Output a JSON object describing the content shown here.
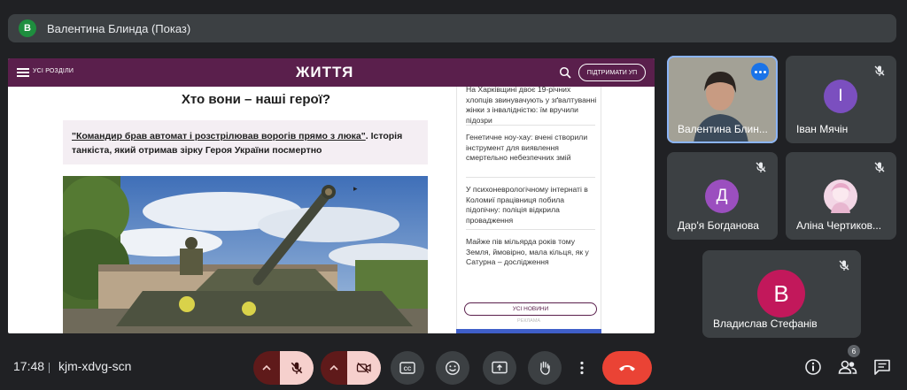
{
  "presenter": {
    "avatar_letter": "В",
    "label": "Валентина Блинда (Показ)"
  },
  "shared_screen": {
    "menu_label": "УСІ РОЗДІЛИ",
    "logo": "ЖИТТЯ",
    "support_button": "ПІДТРИМАТИ УП",
    "article_title": "Хто вони – наші герої?",
    "quote_link_underlined": "\"Командир брав автомат і розстрілював ворогів прямо з люка\"",
    "quote_link_rest": ". Історія танкіста, який отримав зірку Героя України посмертно",
    "news_items": [
      "На Харківщині двоє 19-річних хлопців звинувачують у зґвалтуванні жінки з інвалідністю: їм вручили підозри",
      "Генетичне ноу-хау: вчені створили інструмент для виявлення смертельно небезпечних змій",
      "У психоневрологічному інтернаті в Коломиї працівниця побила підопічну: поліція відкрила провадження",
      "Майже пів мільярда років тому Земля, ймовірно, мала кільця, як у Сатурна – дослідження"
    ],
    "all_news_button": "УСІ НОВИНИ",
    "ad_label": "РЕКЛАМА"
  },
  "participants": [
    {
      "name": "Валентина Блин...",
      "is_self": true
    },
    {
      "name": "Іван Мячін",
      "avatar_letter": "І",
      "avatar_color": "#7b4fbf",
      "muted": true
    },
    {
      "name": "Дар'я Богданова",
      "avatar_letter": "Д",
      "avatar_color": "#9b4fbf",
      "muted": true
    },
    {
      "name": "Аліна Чертиков...",
      "muted": true,
      "has_photo_avatar": true
    },
    {
      "name": "Владислав Стефанів",
      "avatar_letter": "В",
      "avatar_color": "#c2185b",
      "muted": true
    }
  ],
  "toolbar": {
    "time": "17:48",
    "meeting_code": "kjm-xdvg-scn",
    "participant_count": "6"
  },
  "colors": {
    "meet_background": "#202124",
    "tile_background": "#3c4043",
    "end_call": "#ea4335",
    "site_brand": "#5a1f4c"
  }
}
